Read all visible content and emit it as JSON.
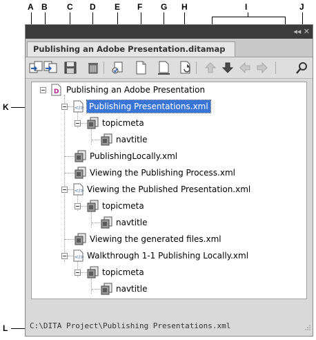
{
  "callouts": {
    "a": "A",
    "b": "B",
    "c": "C",
    "d": "D",
    "e": "E",
    "f": "F",
    "g": "G",
    "h": "H",
    "i": "I",
    "j": "J",
    "k": "K",
    "l": "L"
  },
  "panel": {
    "tab_label": "Publishing an Adobe Presentation.ditamap",
    "title_controls": "◂◂ ✕"
  },
  "toolbar": {
    "icons": [
      "insert-before-icon",
      "insert-after-icon",
      "save-icon",
      "delete-icon",
      "properties-icon",
      "new-topic-icon",
      "rename-icon",
      "refresh-icon",
      "move-up-icon",
      "move-down-icon",
      "move-left-icon",
      "move-right-icon",
      "search-icon"
    ]
  },
  "tree": {
    "nodes": [
      {
        "label": "Publishing an Adobe Presentation",
        "icon": "ditamap-icon"
      },
      {
        "label": "Publishing Presentations.xml",
        "icon": "topicref-icon",
        "selected": true
      },
      {
        "label": "topicmeta",
        "icon": "topicmeta-icon"
      },
      {
        "label": "navtitle",
        "icon": "navtitle-icon"
      },
      {
        "label": "PublishingLocally.xml",
        "icon": "topic-icon"
      },
      {
        "label": "Viewing the Publishing Process.xml",
        "icon": "topic-icon"
      },
      {
        "label": "Viewing the Published Presentation.xml",
        "icon": "topicref-icon"
      },
      {
        "label": "topicmeta",
        "icon": "topicmeta-icon"
      },
      {
        "label": "navtitle",
        "icon": "navtitle-icon"
      },
      {
        "label": "Viewing the generated files.xml",
        "icon": "topic-icon"
      },
      {
        "label": "Walkthrough 1-1 Publishing Locally.xml",
        "icon": "topicref-icon"
      },
      {
        "label": "topicmeta",
        "icon": "topicmeta-icon"
      },
      {
        "label": "navtitle",
        "icon": "navtitle-icon"
      }
    ]
  },
  "status": {
    "path": "C:\\DITA Project\\Publishing Presentations.xml"
  }
}
